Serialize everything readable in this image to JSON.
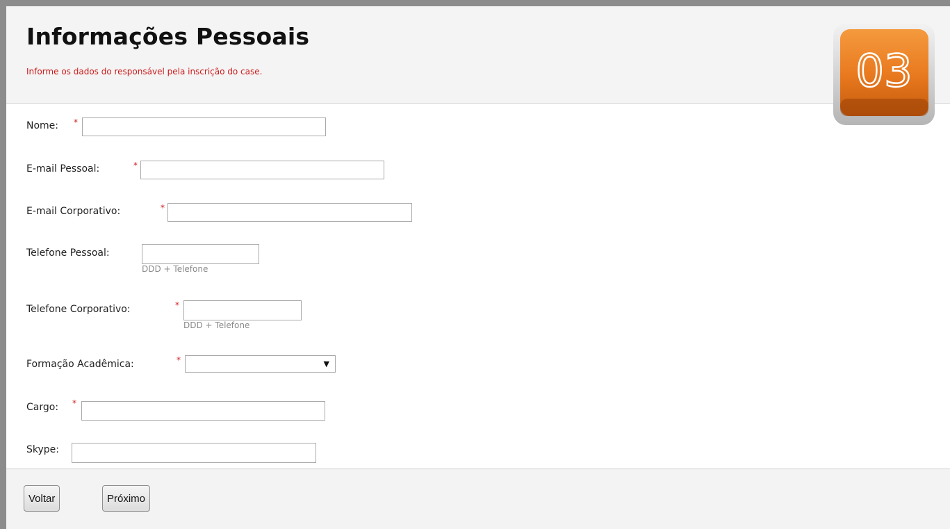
{
  "header": {
    "title": "Informações Pessoais",
    "subtitle": "Informe os dados do responsável pela inscrição do case.",
    "step_number": "03"
  },
  "form": {
    "required_mark": "*",
    "nome": {
      "label": "Nome:",
      "value": ""
    },
    "email_pessoal": {
      "label": "E-mail Pessoal:",
      "value": ""
    },
    "email_corporativo": {
      "label": "E-mail Corporativo:",
      "value": ""
    },
    "telefone_pessoal": {
      "label": "Telefone Pessoal:",
      "value": "",
      "hint": "DDD + Telefone"
    },
    "telefone_corporativo": {
      "label": "Telefone Corporativo:",
      "value": "",
      "hint": "DDD + Telefone"
    },
    "formacao_academica": {
      "label": "Formação Acadêmica:",
      "selected": ""
    },
    "cargo": {
      "label": "Cargo:",
      "value": ""
    },
    "skype": {
      "label": "Skype:",
      "value": ""
    }
  },
  "footer": {
    "back_label": "Voltar",
    "next_label": "Próximo"
  },
  "colors": {
    "accent_orange": "#e8781e",
    "required_red": "#d02020"
  }
}
